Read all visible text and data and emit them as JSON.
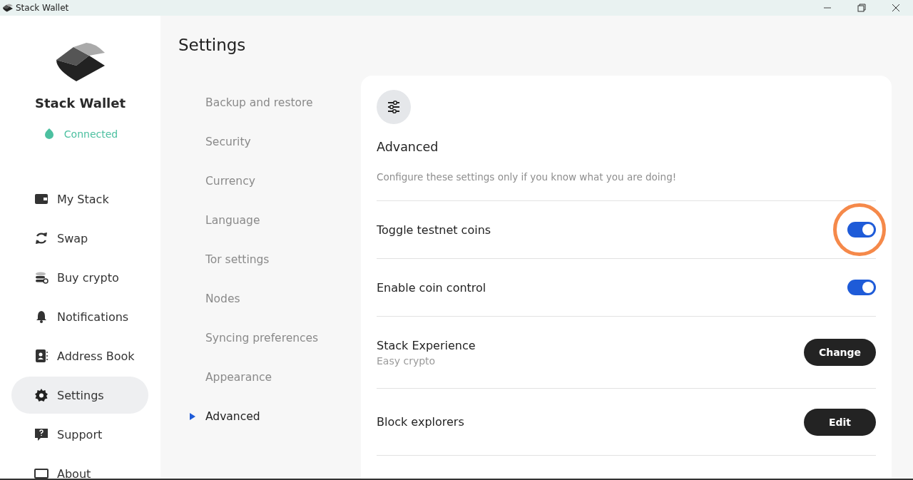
{
  "window": {
    "title": "Stack Wallet"
  },
  "sidebar": {
    "app_name": "Stack Wallet",
    "connection": {
      "label": "Connected",
      "color": "#4cc0a0"
    },
    "items": [
      {
        "label": "My Stack",
        "selected": false
      },
      {
        "label": "Swap",
        "selected": false
      },
      {
        "label": "Buy crypto",
        "selected": false
      },
      {
        "label": "Notifications",
        "selected": false
      },
      {
        "label": "Address Book",
        "selected": false
      },
      {
        "label": "Settings",
        "selected": true
      },
      {
        "label": "Support",
        "selected": false
      },
      {
        "label": "About",
        "selected": false
      }
    ]
  },
  "page_title": "Settings",
  "settings_menu": [
    {
      "label": "Backup and restore",
      "selected": false
    },
    {
      "label": "Security",
      "selected": false
    },
    {
      "label": "Currency",
      "selected": false
    },
    {
      "label": "Language",
      "selected": false
    },
    {
      "label": "Tor settings",
      "selected": false
    },
    {
      "label": "Nodes",
      "selected": false
    },
    {
      "label": "Syncing preferences",
      "selected": false
    },
    {
      "label": "Appearance",
      "selected": false
    },
    {
      "label": "Advanced",
      "selected": true
    }
  ],
  "panel": {
    "title": "Advanced",
    "description": "Configure these settings only if you know what you are doing!",
    "rows": [
      {
        "kind": "toggle",
        "label": "Toggle testnet coins",
        "on": true,
        "highlighted": true
      },
      {
        "kind": "toggle",
        "label": "Enable coin control",
        "on": true,
        "highlighted": false
      },
      {
        "kind": "button",
        "label": "Stack Experience",
        "sublabel": "Easy crypto",
        "button": "Change"
      },
      {
        "kind": "button",
        "label": "Block explorers",
        "button": "Edit"
      }
    ]
  }
}
